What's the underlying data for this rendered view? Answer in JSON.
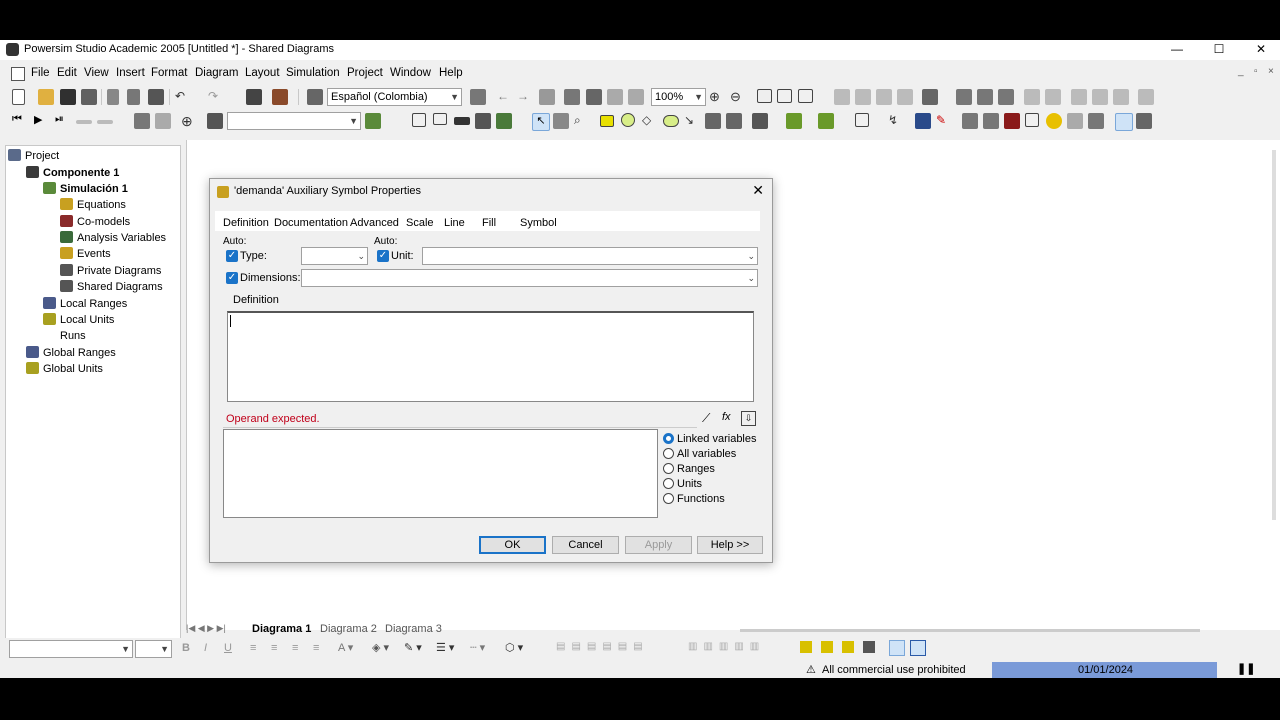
{
  "window": {
    "title": "Powersim Studio Academic 2005 [Untitled *] - Shared Diagrams",
    "minimize": "—",
    "maximize": "☐",
    "close": "✕"
  },
  "menu": [
    "File",
    "Edit",
    "View",
    "Insert",
    "Format",
    "Diagram",
    "Layout",
    "Simulation",
    "Project",
    "Window",
    "Help"
  ],
  "toolbar": {
    "language": "Español (Colombia)",
    "zoom": "100%"
  },
  "tree": {
    "root": "Project",
    "component": "Componente 1",
    "simulation": "Simulación 1",
    "items": [
      "Equations",
      "Co-models",
      "Analysis Variables",
      "Events",
      "Private Diagrams",
      "Shared Diagrams"
    ],
    "local_ranges": "Local Ranges",
    "local_units": "Local Units",
    "runs": "Runs",
    "global_ranges": "Global Ranges",
    "global_units": "Global Units"
  },
  "diagram_tabs": [
    "Diagrama 1",
    "Diagrama 2",
    "Diagrama 3"
  ],
  "status": {
    "warning": "All commercial use prohibited",
    "date": "01/01/2024"
  },
  "dialog": {
    "title": "'demanda' Auxiliary Symbol Properties",
    "close": "✕",
    "tabs": [
      "Definition",
      "Documentation",
      "Advanced",
      "Scale",
      "Line",
      "Fill",
      "Symbol"
    ],
    "auto_label_1": "Auto:",
    "auto_label_2": "Auto:",
    "type_label": "Type:",
    "unit_label": "Unit:",
    "dimensions_label": "Dimensions:",
    "definition_label": "Definition",
    "definition_value": "",
    "error": "Operand expected.",
    "radios": [
      "Linked variables",
      "All variables",
      "Ranges",
      "Units",
      "Functions"
    ],
    "selected_radio": "Linked variables",
    "buttons": {
      "ok": "OK",
      "cancel": "Cancel",
      "apply": "Apply",
      "help": "Help >>"
    },
    "colors": {
      "accent": "#1a73c8",
      "error": "#c0001a"
    }
  }
}
